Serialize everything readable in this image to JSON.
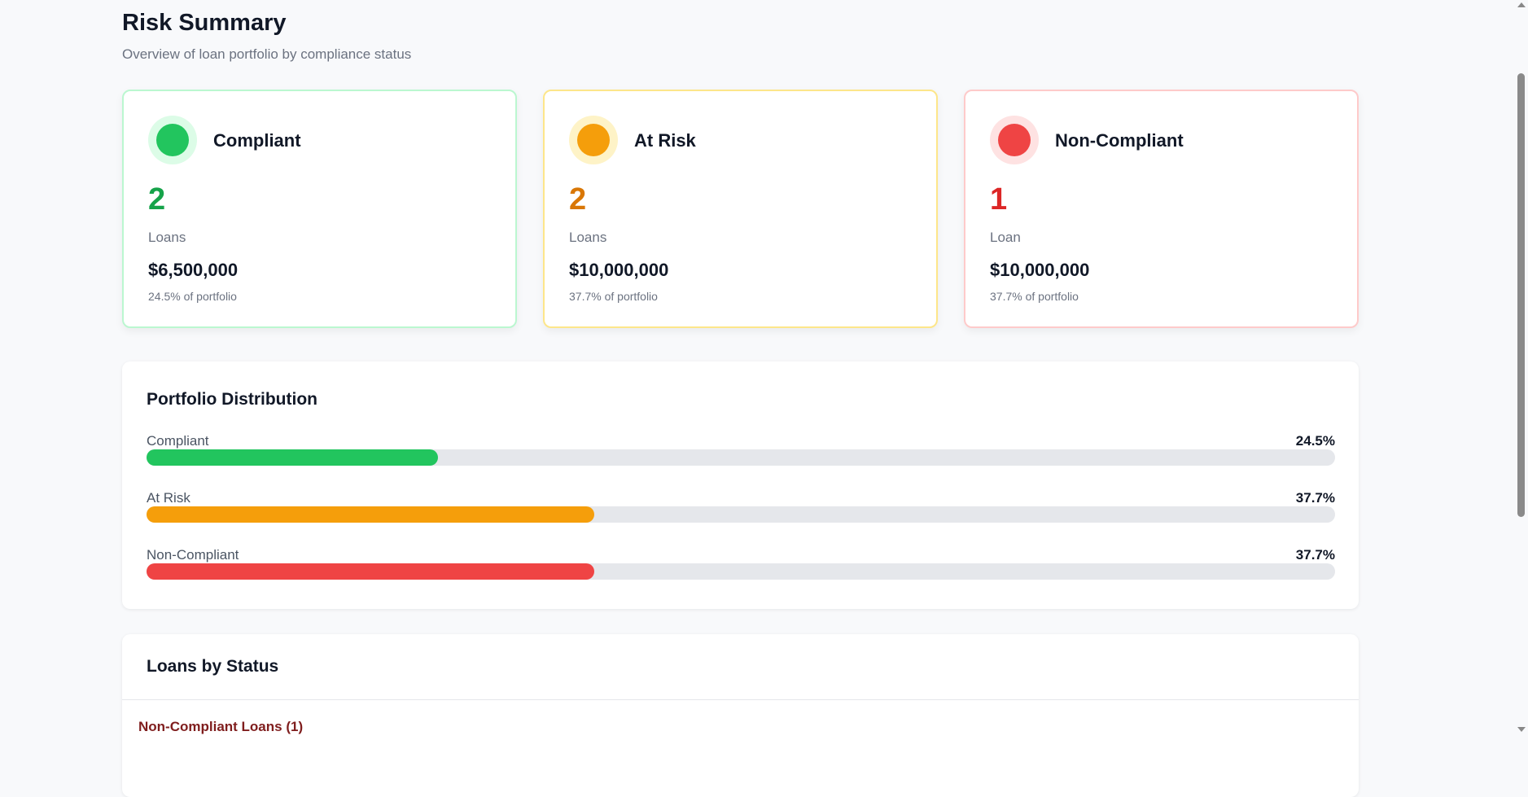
{
  "header": {
    "title": "Risk Summary",
    "subtitle": "Overview of loan portfolio by compliance status"
  },
  "cards": [
    {
      "name": "Compliant",
      "count": "2",
      "unit": "Loans",
      "amount": "$6,500,000",
      "share": "24.5% of portfolio",
      "color": "#22c55e"
    },
    {
      "name": "At Risk",
      "count": "2",
      "unit": "Loans",
      "amount": "$10,000,000",
      "share": "37.7% of portfolio",
      "color": "#f59e0b"
    },
    {
      "name": "Non-Compliant",
      "count": "1",
      "unit": "Loan",
      "amount": "$10,000,000",
      "share": "37.7% of portfolio",
      "color": "#ef4444"
    }
  ],
  "distribution": {
    "title": "Portfolio Distribution",
    "rows": [
      {
        "label": "Compliant",
        "percent_text": "24.5%",
        "percent": 24.5,
        "color": "#22c55e"
      },
      {
        "label": "At Risk",
        "percent_text": "37.7%",
        "percent": 37.7,
        "color": "#f59e0b"
      },
      {
        "label": "Non-Compliant",
        "percent_text": "37.7%",
        "percent": 37.7,
        "color": "#ef4444"
      }
    ]
  },
  "loans": {
    "title": "Loans by Status",
    "group": "Non-Compliant Loans (1)"
  }
}
